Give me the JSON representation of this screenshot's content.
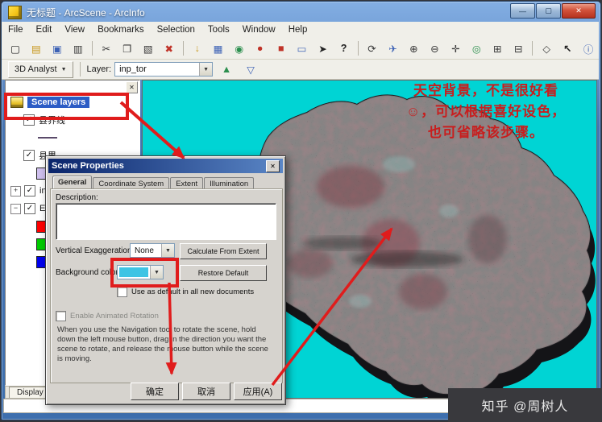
{
  "window": {
    "title": "无标题 - ArcScene - ArcInfo"
  },
  "titlebar": {
    "minimize_glyph": "—",
    "maximize_glyph": "▢",
    "close_glyph": "✕"
  },
  "menu": {
    "items": [
      "File",
      "Edit",
      "View",
      "Bookmarks",
      "Selection",
      "Tools",
      "Window",
      "Help"
    ]
  },
  "toolbar_main": {
    "icons": [
      {
        "name": "new-document-icon",
        "glyph": "▢"
      },
      {
        "name": "open-folder-icon",
        "glyph": "▤"
      },
      {
        "name": "save-icon",
        "glyph": "▣"
      },
      {
        "name": "print-icon",
        "glyph": "▥"
      },
      {
        "name": "cut-icon",
        "glyph": "✂"
      },
      {
        "name": "copy-icon",
        "glyph": "❐"
      },
      {
        "name": "paste-icon",
        "glyph": "▧"
      },
      {
        "name": "delete-icon",
        "glyph": "✖"
      },
      {
        "name": "add-data-icon",
        "glyph": "↓"
      },
      {
        "name": "add-frame-icon",
        "glyph": "▦"
      },
      {
        "name": "globe-icon",
        "glyph": "◉"
      },
      {
        "name": "sphere-icon",
        "glyph": "●"
      },
      {
        "name": "cube-icon",
        "glyph": "■"
      },
      {
        "name": "map-window-icon",
        "glyph": "▭"
      },
      {
        "name": "launch-arcmap-icon",
        "glyph": "➤"
      },
      {
        "name": "help-icon",
        "glyph": "?"
      },
      {
        "name": "navigate-orbit-icon",
        "glyph": "⟳"
      },
      {
        "name": "fly-icon",
        "glyph": "✈"
      },
      {
        "name": "zoom-in-icon",
        "glyph": "⊕"
      },
      {
        "name": "zoom-out-icon",
        "glyph": "⊖"
      },
      {
        "name": "pan-icon",
        "glyph": "✛"
      },
      {
        "name": "full-extent-icon",
        "glyph": "◎"
      },
      {
        "name": "fixed-zoom-in-icon",
        "glyph": "⊞"
      },
      {
        "name": "fixed-zoom-out-icon",
        "glyph": "⊟"
      },
      {
        "name": "center-target-icon",
        "glyph": "◇"
      },
      {
        "name": "select-features-icon",
        "glyph": "↖"
      },
      {
        "name": "identify-icon",
        "glyph": "ⓘ"
      }
    ]
  },
  "toolbar_3d": {
    "analyst_label": "3D Analyst",
    "caret": "▼",
    "layer_label": "Layer:",
    "layer_value": "inp_tor",
    "tin_icon": "▲",
    "steepest_icon": "▽"
  },
  "toc": {
    "close_glyph": "✕",
    "check_glyph": "✓",
    "expand_plus": "+",
    "expand_minus": "−",
    "root_label": "Scene layers",
    "layer1": "县界线",
    "layer2": "县界",
    "layer3": "inp_tor",
    "layer4": "Ex",
    "swatch_lavender": "#cfc0ee",
    "swatch_red": "#ff0000",
    "swatch_green": "#00cc00",
    "swatch_blue": "#0000ee",
    "display_tab": "Display"
  },
  "dialog": {
    "title": "Scene Properties",
    "close_glyph": "✕",
    "tabs": [
      "General",
      "Coordinate System",
      "Extent",
      "Illumination"
    ],
    "description_label": "Description:",
    "description_value": "",
    "vertical_exaggeration_label": "Vertical Exaggeration:",
    "vertical_exaggeration_value": "None",
    "calculate_from_extent": "Calculate From Extent",
    "background_color_label": "Background color:",
    "background_color_hex": "#3ec4e4",
    "restore_default": "Restore Default",
    "use_default_label": "Use as default in all new documents",
    "animated_rotation_label": "Enable Animated Rotation",
    "rotation_help": "When you use the Navigation tool to rotate the scene, hold down the left mouse button, drag in the direction you want the scene to rotate, and release the mouse button while the scene is moving.",
    "ok": "确定",
    "cancel": "取消",
    "apply": "应用(A)"
  },
  "viewport": {
    "background": "#00d4d4",
    "annotation_color": "#c81e1e",
    "annotation_lines": [
      "天空背景，不是很好看",
      "☺，可以根据喜好设色，",
      "也可省略该步骤。"
    ]
  },
  "watermark": {
    "text": "知乎 @周树人"
  },
  "statusbar": {
    "text": ""
  }
}
